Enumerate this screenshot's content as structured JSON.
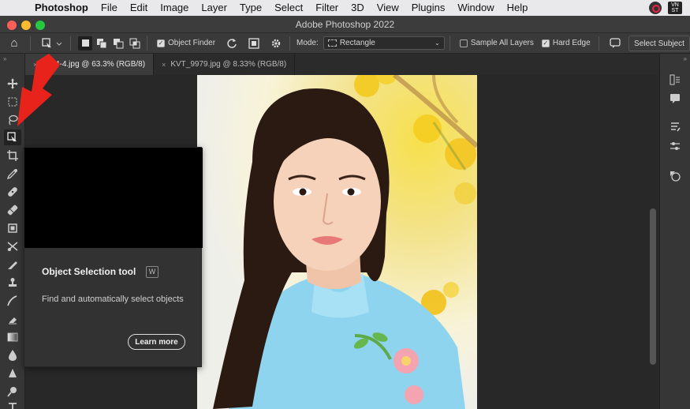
{
  "menubar": {
    "app": "Photoshop",
    "items": [
      "File",
      "Edit",
      "Image",
      "Layer",
      "Type",
      "Select",
      "Filter",
      "3D",
      "View",
      "Plugins",
      "Window",
      "Help"
    ],
    "input_source": "VN ST"
  },
  "window": {
    "title": "Adobe Photoshop 2022"
  },
  "options": {
    "object_finder": "Object Finder",
    "mode_label": "Mode:",
    "mode_value": "Rectangle",
    "sample_all_layers": "Sample All Layers",
    "hard_edge": "Hard Edge",
    "select_subject": "Select Subject",
    "checkbox_mark": "✓"
  },
  "tabs": [
    {
      "label": "9754-4.jpg @ 63.3% (RGB/8)",
      "close": "×"
    },
    {
      "label": "KVT_9979.jpg @ 8.33% (RGB/8)",
      "close": "×"
    }
  ],
  "tooltip": {
    "title": "Object Selection tool",
    "shortcut": "W",
    "description": "Find and automatically select objects",
    "learn_more": "Learn more"
  },
  "icons": {
    "apple": "",
    "home": "⌂",
    "collapse": "»"
  },
  "colors": {
    "accent_arrow": "#e8231b",
    "panel": "#363636",
    "canvas": "#282828"
  }
}
